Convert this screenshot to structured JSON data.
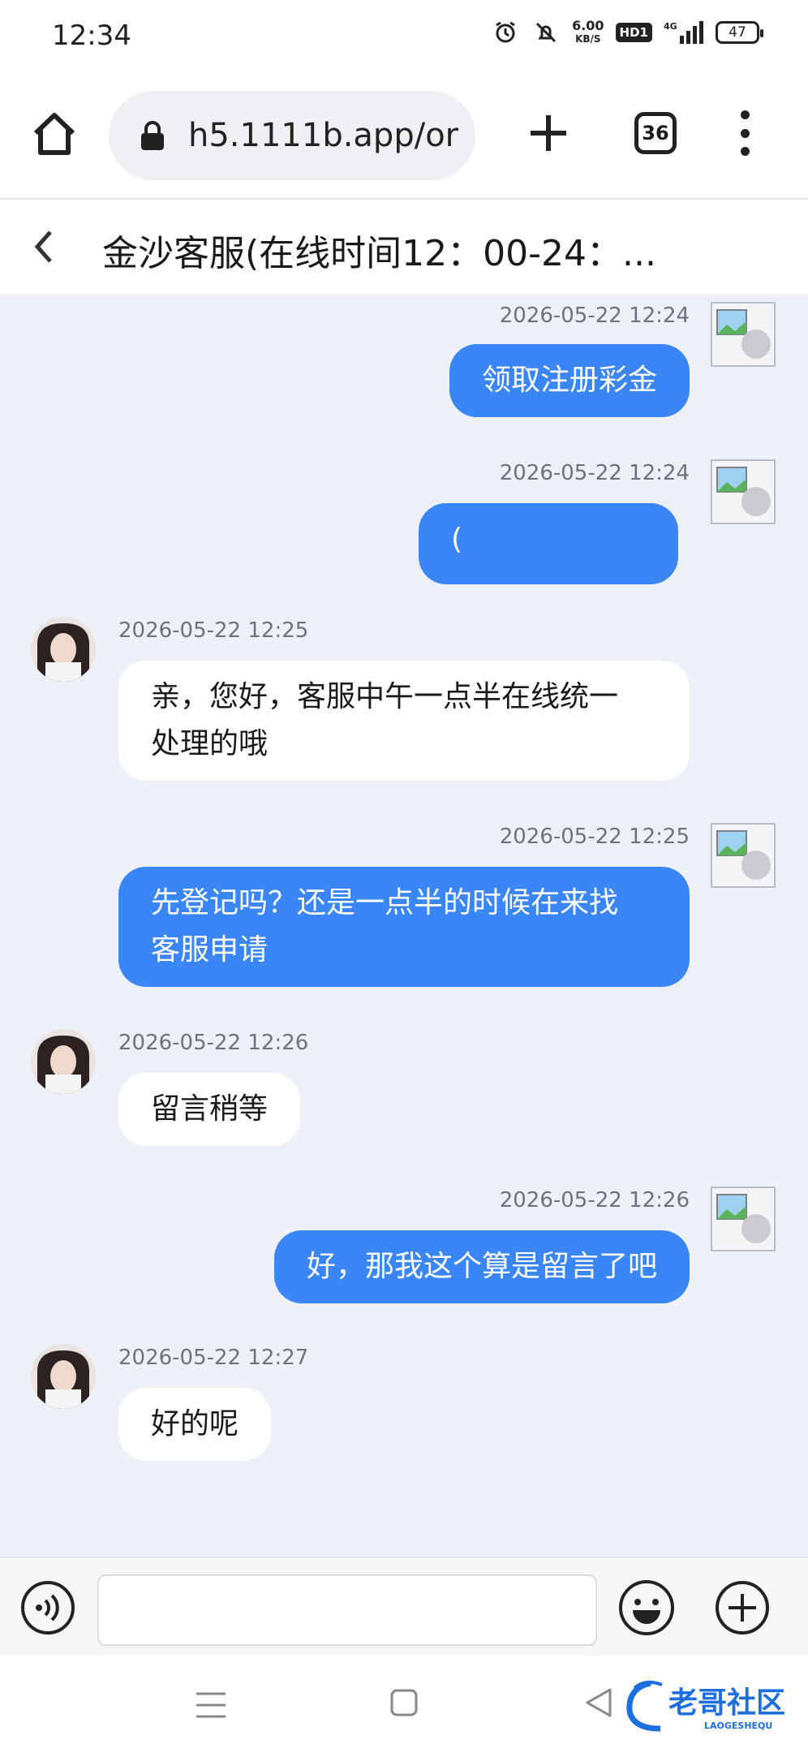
{
  "status_bar": {
    "time": "12:34",
    "speed_value": "6.00",
    "speed_unit": "KB/S",
    "hd_label": "HD1",
    "network_label": "4G",
    "battery": "47"
  },
  "browser": {
    "url": "h5.1111b.app/or",
    "tab_count": "36"
  },
  "chat_header": {
    "title": "金沙客服(在线时间12：00-24：..."
  },
  "messages": [
    {
      "side": "out",
      "timestamp": "2026-05-22 12:24",
      "text": "领取注册彩金"
    },
    {
      "side": "out",
      "timestamp": "2026-05-22 12:24",
      "text": "("
    },
    {
      "side": "in",
      "timestamp": "2026-05-22 12:25",
      "text_line1": "亲，您好，客服中午一点半在线统一",
      "text_line2": "处理的哦"
    },
    {
      "side": "out",
      "timestamp": "2026-05-22 12:25",
      "text_line1": "先登记吗？还是一点半的时候在来找",
      "text_line2": "客服申请"
    },
    {
      "side": "in",
      "timestamp": "2026-05-22 12:26",
      "text": "留言稍等"
    },
    {
      "side": "out",
      "timestamp": "2026-05-22 12:26",
      "text": "好，那我这个算是留言了吧"
    },
    {
      "side": "in",
      "timestamp": "2026-05-22 12:27",
      "text": "好的呢"
    }
  ],
  "input_bar": {
    "placeholder": ""
  },
  "watermark": {
    "text": "老哥社区",
    "subtext": "LAOGESHEQU"
  },
  "colors": {
    "outgoing_bubble": "#3a86f7",
    "incoming_bubble": "#ffffff",
    "chat_background": "#eef0f7"
  }
}
